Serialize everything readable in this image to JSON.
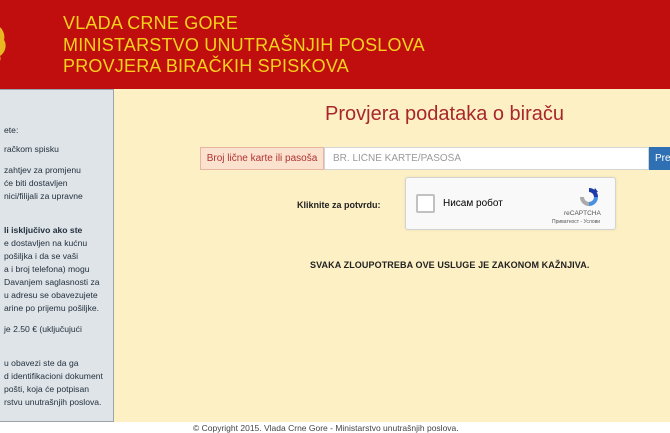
{
  "header": {
    "line1": "VLADA CRNE GORE",
    "line2": "MINISTARSTVO UNUTRAŠNJIH POSLOVA",
    "line3": "PROVJERA BIRAČKIH SPISKOVA",
    "emblem_icon": "coat-of-arms-icon",
    "bg_color": "#c00d0d",
    "text_color": "#f4d21d"
  },
  "sidebar": {
    "lines": [
      "ete:",
      "račkom spisku",
      "zahtjev za promjenu",
      "će biti dostavljen",
      "nici/filijali za upravne",
      "li isključivo ako ste",
      "e dostavljen na kućnu",
      "pošiljka i da se vaši",
      "a i broj telefona) mogu",
      "Davanjem saglasnosti za",
      "u adresu se obavezujete",
      "arine po prijemu pošiljke.",
      "je 2.50 € (uključujući",
      "u obavezi ste da ga",
      "d identifikacioni dokument",
      "pošti, koja će potpisan",
      "rstvu unutrašnjih poslova."
    ]
  },
  "main": {
    "title": "Provjera podataka o biraču",
    "id_label": "Broj lične karte ili pasoša",
    "id_placeholder": "BR. LIČNE KARTE/PASOŠA",
    "id_value": "",
    "submit_label": "Pre",
    "confirm_label": "Kliknite za potvrdu:",
    "recaptcha": {
      "checkbox_label": "Нисам робот",
      "brand": "reCAPTCHA",
      "privacy": "Приватност",
      "separator": "-",
      "terms": "Услови",
      "logo_icon": "recaptcha-logo-icon"
    },
    "warning": "SVAKA ZLOUPOTREBA OVE USLUGE JE ZAKONOM KAŽNJIVA.",
    "bg_color": "#fdf0c4",
    "title_color": "#a8272b"
  },
  "footer": {
    "text": "© Copyright 2015. Vlada Crne Gore - Ministarstvo unutrašnjih poslova."
  }
}
